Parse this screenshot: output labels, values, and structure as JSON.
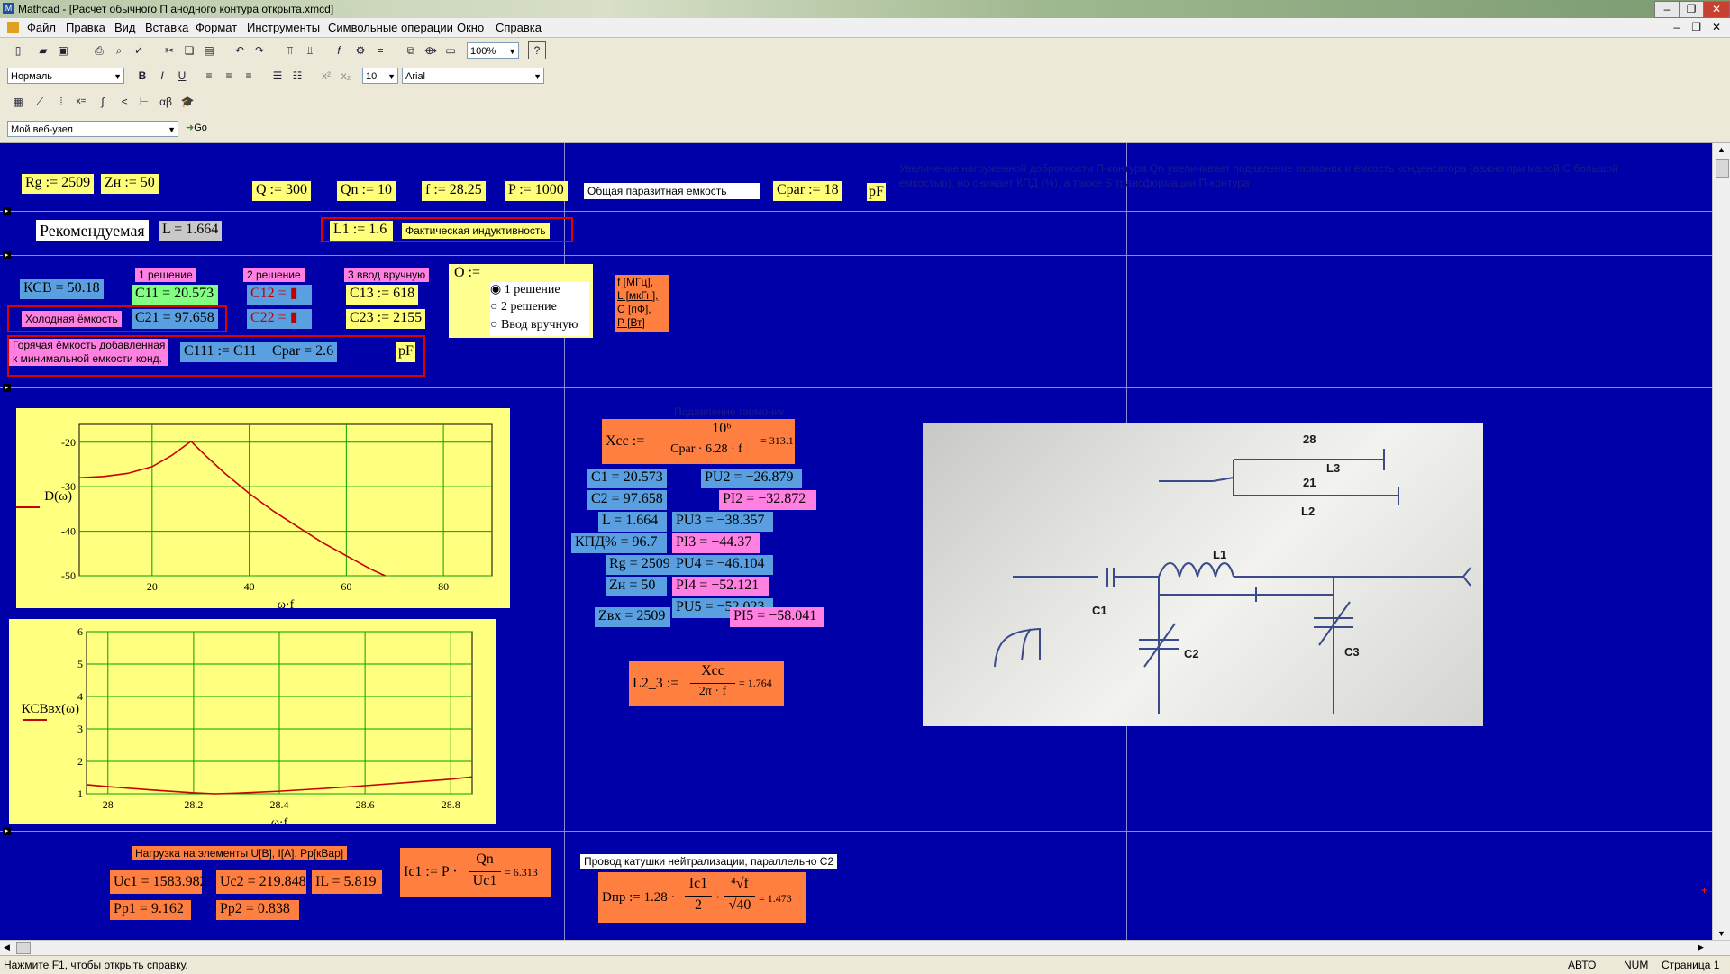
{
  "window": {
    "title": "Mathcad - [Расчет обычного П анодного контура открыта.xmcd]"
  },
  "menu": [
    "Файл",
    "Правка",
    "Вид",
    "Вставка",
    "Формат",
    "Инструменты",
    "Символьные операции",
    "Окно",
    "Справка"
  ],
  "toolbar": {
    "zoom": "100%",
    "style": "Нормаль",
    "font_size": "10",
    "font": "Arial",
    "web": "Мой веб-узел",
    "go": "Go"
  },
  "inputs": {
    "rg": "Rg := 2509",
    "zn": "Zн := 50",
    "q": "Q := 300",
    "qn": "Qn := 10",
    "f": "f := 28.25",
    "p": "P := 1000",
    "parasitic_label": "Общая паразитная емкость",
    "cpar": "Cpar := 18",
    "cpar_unit": "pF",
    "note": "Увеличение нагруженной добротности П-контура Qn увеличивает подавление гармоник и ёмкость конденсатора (важно при малой С большой емкостью), но снижает КПД (%), а также S трансформации П-контура"
  },
  "recommended": {
    "label": "Рекомендуемая",
    "value": "L = 1.664",
    "l1": "L1 := 1.6",
    "l1_label": "Фактическая индуктивность"
  },
  "solutions": {
    "ksv": "КСВ = 50.18",
    "h1": "1 решение",
    "h2": "2 решение",
    "h3": "3 ввод вручную",
    "c11": "C11 = 20.573",
    "c12": "C12 = ▮",
    "c13": "C13 := 618",
    "c21": "C21 = 97.658",
    "c22": "C22 = ▮",
    "c23": "C23 := 2155",
    "cold_label": "Холодная ёмкость",
    "hot_label_1": "Горячая ёмкость добавленная",
    "hot_label_2": "к минимальной емкости конд.",
    "c111": "C111 := C11 − Cpar = 2.6",
    "pf": "pF",
    "o_label": "O :=",
    "radio": [
      "1 решение",
      "2 решение",
      "Ввод вручную"
    ],
    "units": [
      "f [МГц],",
      "L [мкГн],",
      "C [пФ],",
      "P [Вт]"
    ]
  },
  "chart_data": [
    {
      "type": "line",
      "title": "",
      "xlabel": "ω·f",
      "ylabel": "D(ω)",
      "xlim": [
        5,
        90
      ],
      "ylim": [
        -50,
        -16
      ],
      "grid": true,
      "x": [
        5,
        10,
        15,
        20,
        24,
        28,
        31,
        35,
        40,
        45,
        50,
        55,
        60,
        65,
        68
      ],
      "values": [
        -28,
        -27.7,
        -27,
        -25.5,
        -23,
        -19.8,
        -23,
        -27,
        -31.5,
        -35.5,
        -39,
        -42.5,
        -45.5,
        -48.5,
        -50
      ],
      "xticks": [
        20,
        40,
        60,
        80
      ],
      "yticks": [
        -20,
        -30,
        -40,
        -50
      ]
    },
    {
      "type": "line",
      "title": "",
      "xlabel": "ω·f",
      "ylabel": "КСВвх(ω)",
      "xlim": [
        27.95,
        28.85
      ],
      "ylim": [
        1,
        6
      ],
      "grid": true,
      "x": [
        27.95,
        28.0,
        28.1,
        28.2,
        28.25,
        28.3,
        28.4,
        28.5,
        28.6,
        28.7,
        28.8,
        28.85
      ],
      "values": [
        1.28,
        1.22,
        1.12,
        1.03,
        1.0,
        1.02,
        1.08,
        1.16,
        1.25,
        1.35,
        1.45,
        1.52
      ],
      "xticks": [
        28,
        28.2,
        28.4,
        28.6,
        28.8
      ],
      "yticks": [
        1,
        2,
        3,
        4,
        5,
        6
      ]
    }
  ],
  "results": {
    "header": "Подавление гармоник",
    "xcc_top": "10⁶",
    "xcc_left": "Xcc :=",
    "xcc_bottom": "Cpar · 6.28 · f",
    "xcc_val": "= 313.1",
    "c1": "C1 = 20.573",
    "c2": "C2 = 97.658",
    "l": "L = 1.664",
    "kpd": "КПД% = 96.7",
    "rg": "Rg = 2509",
    "zn": "Zн = 50",
    "zvx": "Zвх = 2509",
    "pu2": "PU2 = −26.879",
    "pi2": "PI2 = −32.872",
    "pu3": "PU3 = −38.357",
    "pi3": "PI3 = −44.37",
    "pu4": "PU4 = −46.104",
    "pi4": "PI4 = −52.121",
    "pu5": "PU5 = −52.023",
    "pi5": "PI5 = −58.041",
    "l23_left": "L2_3 :=",
    "l23_top": "Xcc",
    "l23_bottom": "2π · f",
    "l23_val": "= 1.764"
  },
  "photo": {
    "labels": [
      "28",
      "L3",
      "21",
      "L2",
      "L1",
      "C1",
      "C2",
      "C3"
    ]
  },
  "loads": {
    "header": "Нагрузка на элементы U[В], I[А], Pp[кВар]",
    "uc1": "Uc1 = 1583.982",
    "uc2": "Uc2 = 219.848",
    "il": "IL = 5.819",
    "pp1": "Pp1 = 9.162",
    "pp2": "Pp2 = 0.838",
    "ic1_left": "Ic1 := P ·",
    "ic1_top": "Qn",
    "ic1_bottom": "Uc1",
    "ic1_val": "= 6.313",
    "wire_label": "Провод катушки нейтрализации, параллельно С2",
    "dpr_left": "Dпр := 1.28 ·",
    "dpr_top": "Ic1",
    "dpr_bottom": "2",
    "dpr_mid": "·",
    "dpr_top2": "⁴√f",
    "dpr_bottom2": "√40",
    "dpr_val": "= 1.473"
  },
  "status": {
    "hint": "Нажмите F1, чтобы открыть справку.",
    "mode": "АВТО",
    "num": "NUM",
    "page": "Страница 1"
  }
}
